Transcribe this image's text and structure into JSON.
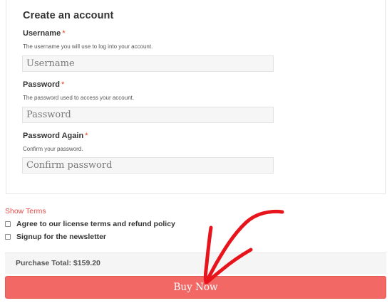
{
  "form": {
    "title": "Create an account",
    "required_marker": "*",
    "username": {
      "label": "Username",
      "description": "The username you will use to log into your account.",
      "placeholder": "Username",
      "value": ""
    },
    "password": {
      "label": "Password",
      "description": "The password used to access your account.",
      "placeholder": "Password",
      "value": ""
    },
    "password_again": {
      "label": "Password Again",
      "description": "Confirm your password.",
      "placeholder": "Confirm password",
      "value": ""
    }
  },
  "terms": {
    "show_terms_link": "Show Terms",
    "agree_label": "Agree to our license terms and refund policy",
    "agree_checked": false,
    "newsletter_label": "Signup for the newsletter",
    "newsletter_checked": false
  },
  "purchase": {
    "total_label": "Purchase Total:",
    "total_value": "$159.20",
    "buy_button_label": "Buy Now"
  },
  "colors": {
    "accent": "#f16864",
    "required": "#e2401c",
    "link": "#e24a4a",
    "annotation_arrow": "#e8141c"
  },
  "annotation": {
    "icon": "hand-drawn-red-arrow-icon"
  }
}
